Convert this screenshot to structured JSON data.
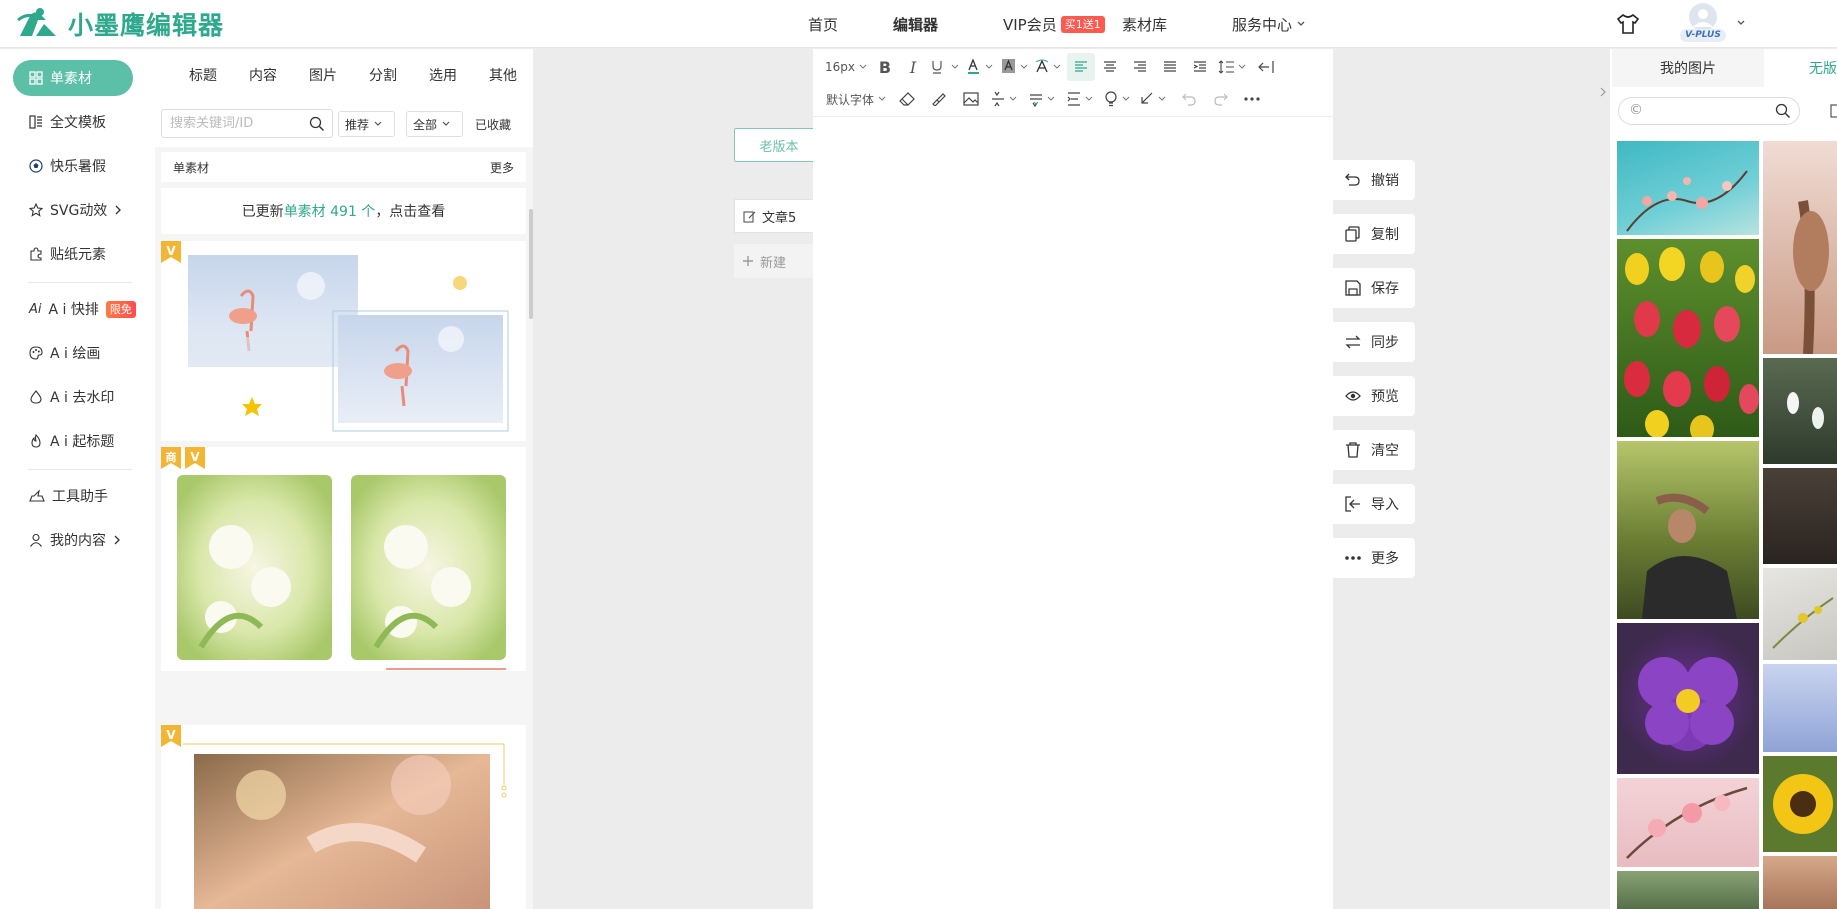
{
  "brand": {
    "name": "小墨鹰编辑器",
    "color": "#2fa98e"
  },
  "nav": {
    "home": "首页",
    "editor": "编辑器",
    "vip": "VIP会员",
    "vip_badge": "买1送1",
    "library": "素材库",
    "service": "服务中心",
    "avatar_label": "V-PLUS"
  },
  "sidebar": {
    "items": [
      {
        "label": "单素材",
        "icon": "grid-icon"
      },
      {
        "label": "全文模板",
        "icon": "template-icon"
      },
      {
        "label": "快乐暑假",
        "icon": "soccer-ball-icon"
      },
      {
        "label": "SVG动效",
        "icon": "star-icon"
      },
      {
        "label": "贴纸元素",
        "icon": "puzzle-icon"
      },
      {
        "label": "A i 快排",
        "icon": "ai-icon",
        "badge": "限免"
      },
      {
        "label": "A i 绘画",
        "icon": "palette-icon"
      },
      {
        "label": "A i 去水印",
        "icon": "drop-icon"
      },
      {
        "label": "A i 起标题",
        "icon": "flame-icon"
      },
      {
        "label": "工具助手",
        "icon": "tools-icon"
      },
      {
        "label": "我的内容",
        "icon": "user-icon"
      }
    ]
  },
  "materials": {
    "tabs": [
      "标题",
      "内容",
      "图片",
      "分割",
      "选用",
      "其他"
    ],
    "search_placeholder": "搜索关键词/ID",
    "sort": "推荐",
    "scope": "全部",
    "favorites": "已收藏",
    "section_title": "单素材",
    "more": "更多",
    "update_prefix": "已更新",
    "update_link": "单素材 491 个",
    "update_suffix": "，点击查看",
    "tag_vip": "V",
    "tag_commercial": "商"
  },
  "workspace": {
    "old_version": "老版本",
    "doc_name": "文章5",
    "new_doc": "新建"
  },
  "toolbar": {
    "font_size": "16px",
    "font_family": "默认字体"
  },
  "side_actions": [
    "撤销",
    "复制",
    "保存",
    "同步",
    "预览",
    "清空",
    "导入",
    "更多"
  ],
  "right_panel": {
    "tab_mine": "我的图片",
    "tab_free": "无版",
    "search_prefix": "©"
  },
  "colors": {
    "accent": "#5cbfa7",
    "accent_dark": "#2fa98e",
    "badge_red": "#ff5a4f",
    "vip_gold": "#f3b534"
  }
}
